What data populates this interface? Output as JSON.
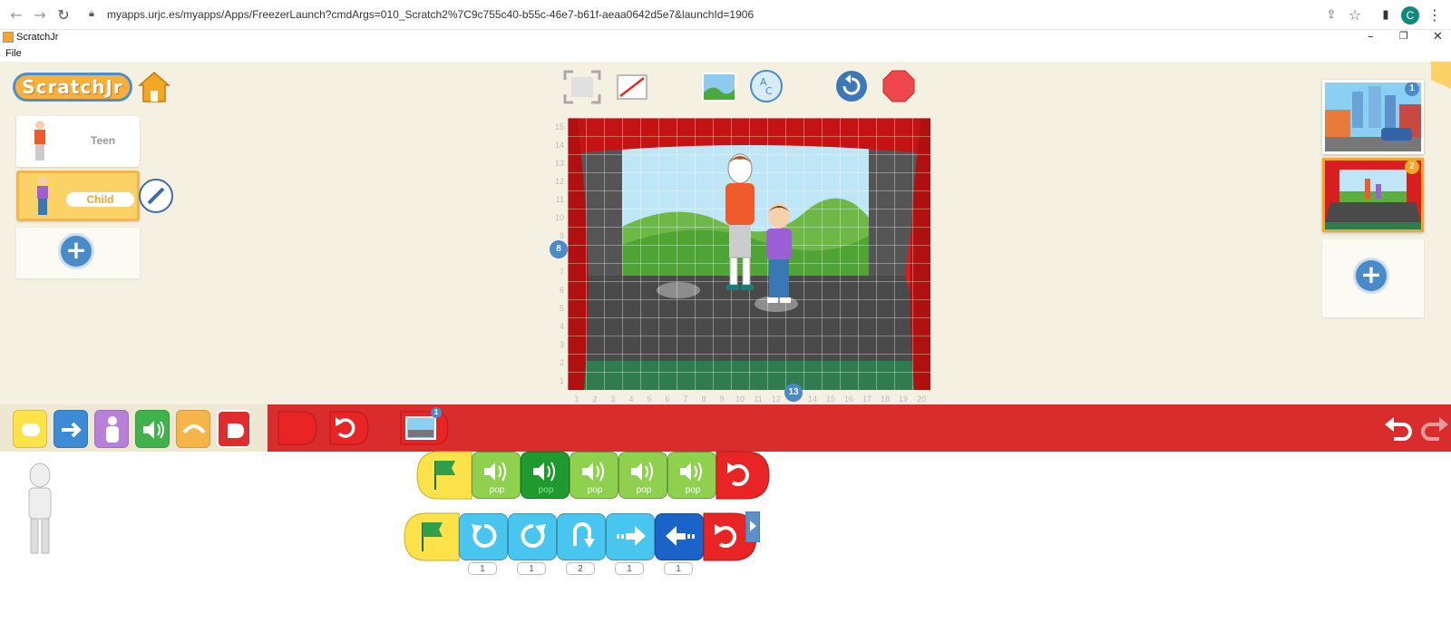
{
  "browser": {
    "url": "myapps.urjc.es/myapps/Apps/FreezerLaunch?cmdArgs=010_Scratch2%7C9c755c40-b55c-46e7-b61f-aeaa0642d5e7&launchId=1906",
    "profile_initial": "C"
  },
  "window": {
    "title": "ScratchJr",
    "menu_file": "File"
  },
  "app": {
    "logo_text": "ScratchJr",
    "sprites": [
      {
        "name": "Teen"
      },
      {
        "name": "Child"
      }
    ],
    "stage": {
      "row_numbers": [
        "15",
        "14",
        "13",
        "12",
        "11",
        "10",
        "9",
        "8",
        "7",
        "6",
        "5",
        "4",
        "3",
        "2",
        "1"
      ],
      "col_numbers": [
        "1",
        "2",
        "3",
        "4",
        "5",
        "6",
        "7",
        "8",
        "9",
        "10",
        "11",
        "12",
        "13",
        "14",
        "15",
        "16",
        "17",
        "18",
        "19",
        "20"
      ],
      "selected_row": "8",
      "selected_col": "13"
    },
    "pages": [
      {
        "number": "1"
      },
      {
        "number": "2"
      }
    ],
    "palette_page_badge": "1"
  },
  "scripts": {
    "row1": [
      {
        "type": "green-flag"
      },
      {
        "type": "play-sound",
        "label": "pop"
      },
      {
        "type": "play-sound",
        "label": "pop"
      },
      {
        "type": "play-sound",
        "label": "pop"
      },
      {
        "type": "play-sound",
        "label": "pop"
      },
      {
        "type": "play-sound",
        "label": "pop"
      },
      {
        "type": "repeat-forever"
      }
    ],
    "row2": [
      {
        "type": "green-flag"
      },
      {
        "type": "turn-left",
        "value": "1"
      },
      {
        "type": "turn-right",
        "value": "1"
      },
      {
        "type": "hop",
        "value": "2"
      },
      {
        "type": "move-right",
        "value": "1"
      },
      {
        "type": "move-left",
        "value": "1"
      },
      {
        "type": "repeat-forever"
      }
    ]
  },
  "colors": {
    "stage_curtain": "#d81e1e",
    "palette_bar": "#d92c2c",
    "sound_block": "#8fd14f",
    "motion_block": "#49c6f0",
    "trigger_block": "#fde24a",
    "end_block": "#e02c2c"
  }
}
